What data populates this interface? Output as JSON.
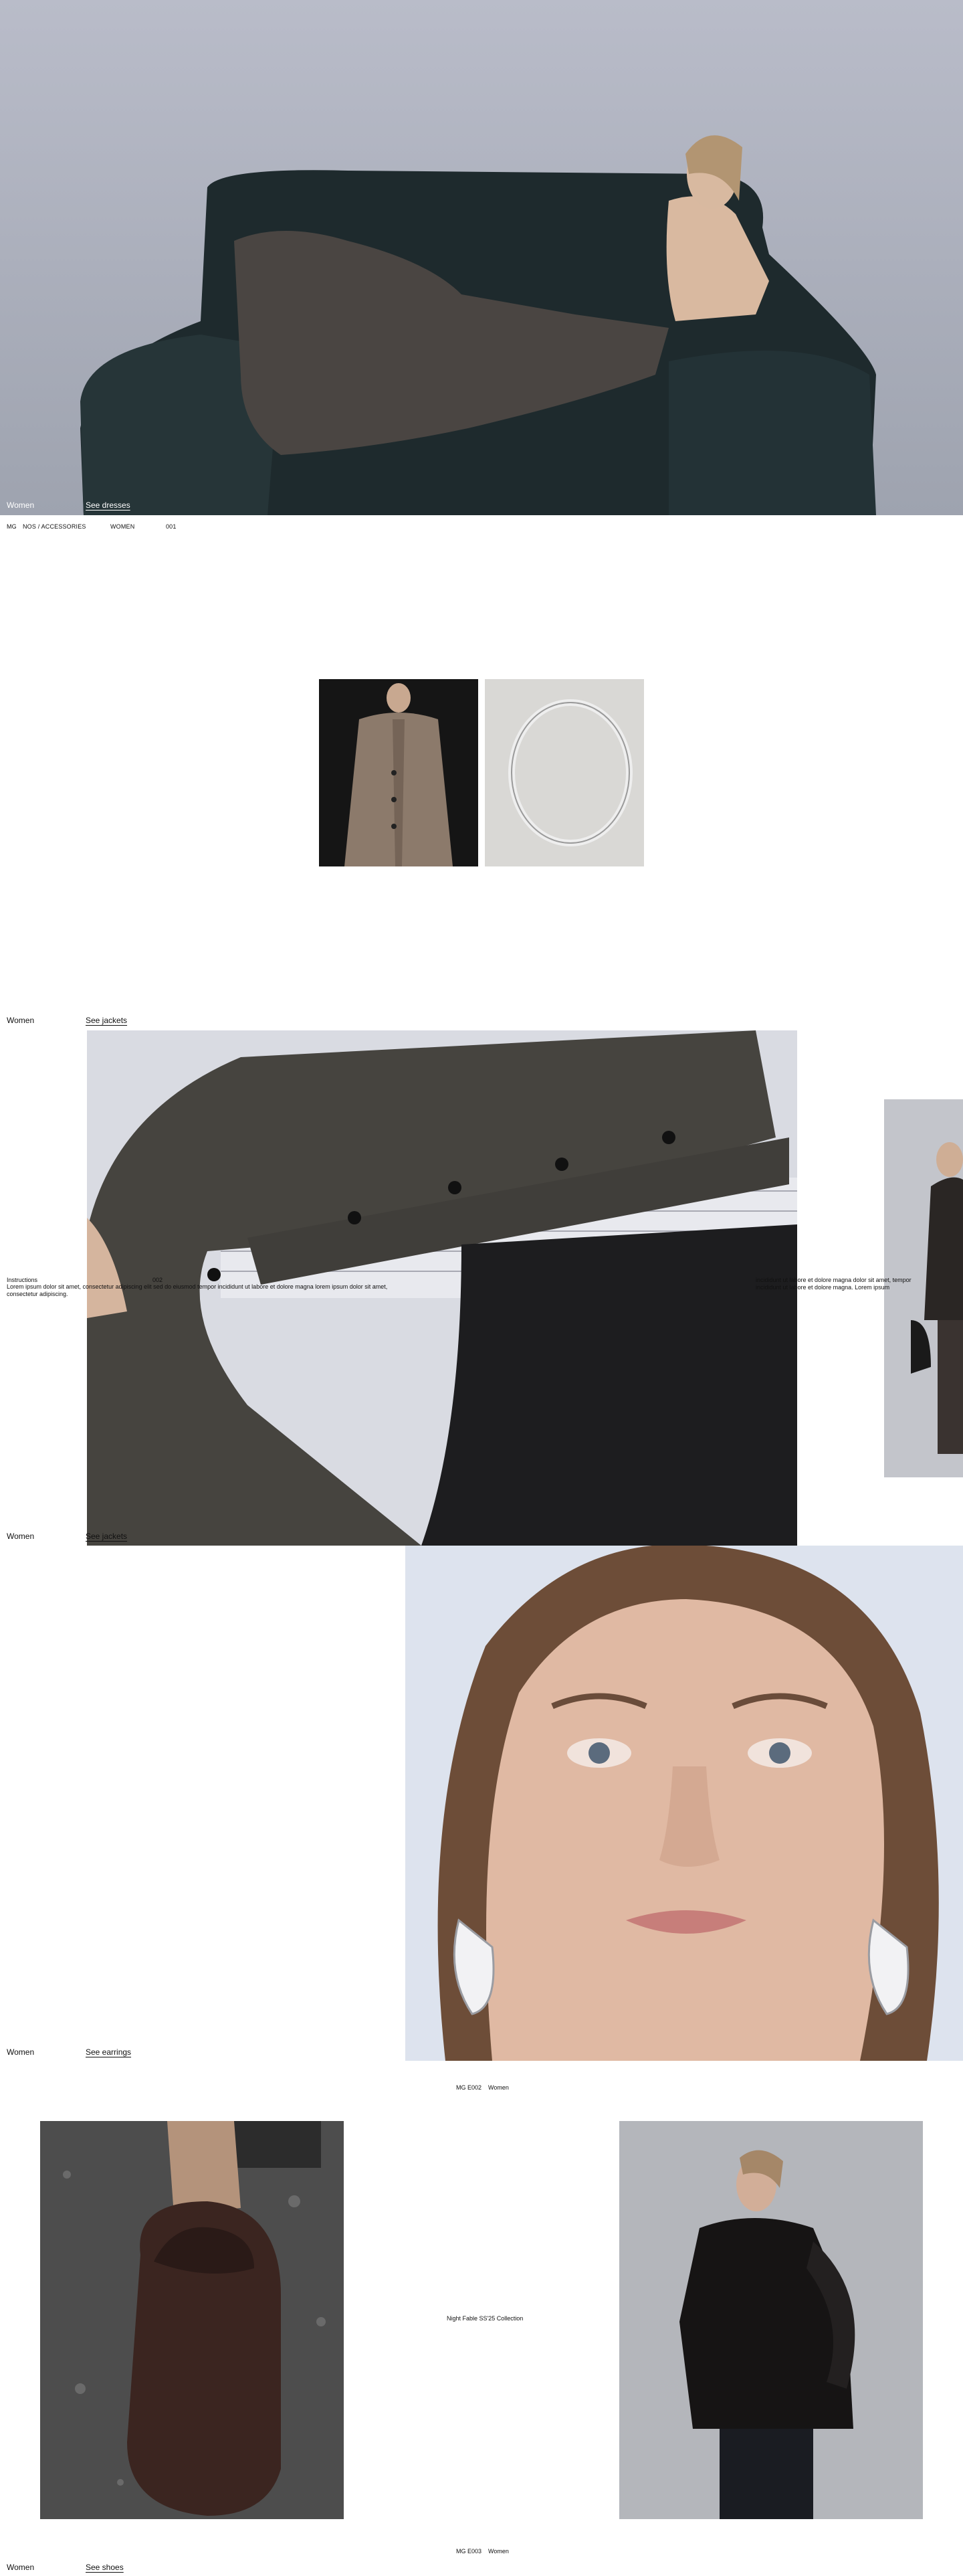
{
  "hero": {
    "category": "Women",
    "link": "See dresses"
  },
  "meta_bar": {
    "brand": "MG",
    "collection": "NOS / ACCESSORIES",
    "section": "WOMEN",
    "number": "001"
  },
  "section_jackets_top": {
    "category": "Women",
    "link": "See jackets"
  },
  "marquee": {
    "left_heading": "Instructions",
    "left_number": "002",
    "left_body": "Lorem ipsum dolor sit amet, consectetur adipiscing elit sed do eiusmod tempor incididunt ut labore et dolore magna lorem ipsum dolor sit amet, consectetur adipiscing.",
    "right_body": "incididunt ut labore et dolore magna dolor sit amet, tempor incididunt ut labore et dolore magna. Lorem ipsum"
  },
  "section_jackets_bottom": {
    "category": "Women",
    "link": "See jackets"
  },
  "section_earrings": {
    "category": "Women",
    "link": "See earrings"
  },
  "label_pair_1": {
    "code": "MG E002",
    "category": "Women"
  },
  "collection_title": "Night Fable SS'25 Collection",
  "label_pair_2": {
    "code": "MG E003",
    "category": "Women"
  },
  "section_shoes": {
    "category": "Women",
    "link": "See shoes"
  },
  "colors": {
    "hero_bg": "#b9bcc6",
    "sofa": "#1f2a2e",
    "suede": "#4a4542",
    "skin": "#d8b9a0",
    "grey_bg": "#b3b5ba"
  }
}
